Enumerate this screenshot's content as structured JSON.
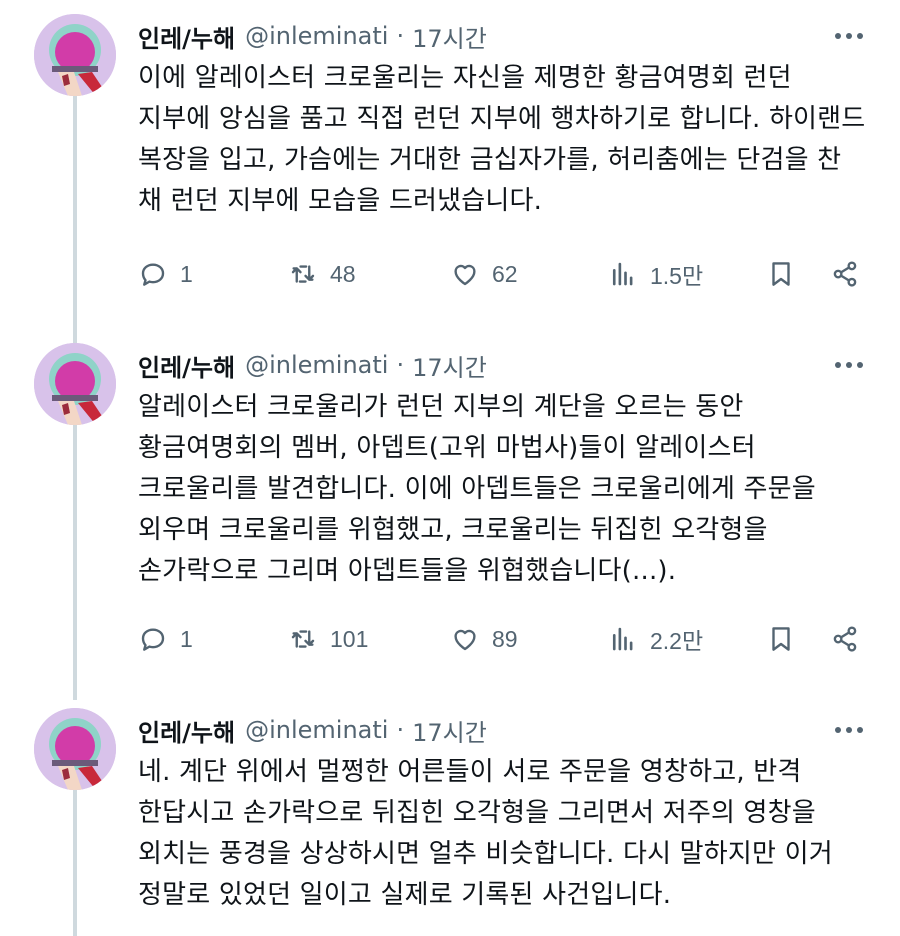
{
  "tweets": [
    {
      "display_name": "인레/누해",
      "handle": "@inleminati",
      "separator": "·",
      "time": "17시간",
      "text": "이에 알레이스터 크로울리는 자신을 제명한 황금여명회 런던 지부에 앙심을 품고 직접 런던 지부에 행차하기로 합니다. 하이랜드 복장을 입고, 가슴에는 거대한 금십자가를, 허리춤에는 단검을 찬 채 런던 지부에 모습을 드러냈습니다.",
      "replies": "1",
      "retweets": "48",
      "likes": "62",
      "views": "1.5만"
    },
    {
      "display_name": "인레/누해",
      "handle": "@inleminati",
      "separator": "·",
      "time": "17시간",
      "text": "알레이스터 크로울리가 런던 지부의 계단을 오르는 동안 황금여명회의 멤버, 아뎁트(고위 마법사)들이 알레이스터 크로울리를 발견합니다. 이에 아뎁트들은 크로울리에게 주문을 외우며 크로울리를 위협했고, 크로울리는 뒤집힌 오각형을 손가락으로 그리며 아뎁트들을 위협했습니다(...).",
      "replies": "1",
      "retweets": "101",
      "likes": "89",
      "views": "2.2만"
    },
    {
      "display_name": "인레/누해",
      "handle": "@inleminati",
      "separator": "·",
      "time": "17시간",
      "text": "네. 계단 위에서 멀쩡한 어른들이 서로 주문을 영창하고, 반격 한답시고 손가락으로 뒤집힌 오각형을 그리면서 저주의 영창을 외치는 풍경을 상상하시면 얼추 비슷합니다. 다시 말하지만 이거 정말로 있었던 일이고 실제로 기록된 사건입니다."
    }
  ],
  "icons": {
    "more": "more-horizontal-icon",
    "reply": "reply-icon",
    "retweet": "retweet-icon",
    "like": "heart-icon",
    "views": "views-chart-icon",
    "bookmark": "bookmark-icon",
    "share": "share-icon"
  },
  "colors": {
    "text": "#0f1419",
    "secondary": "#536471",
    "thread_line": "#cfd9de",
    "avatar_bg": "#d8c2ea"
  }
}
